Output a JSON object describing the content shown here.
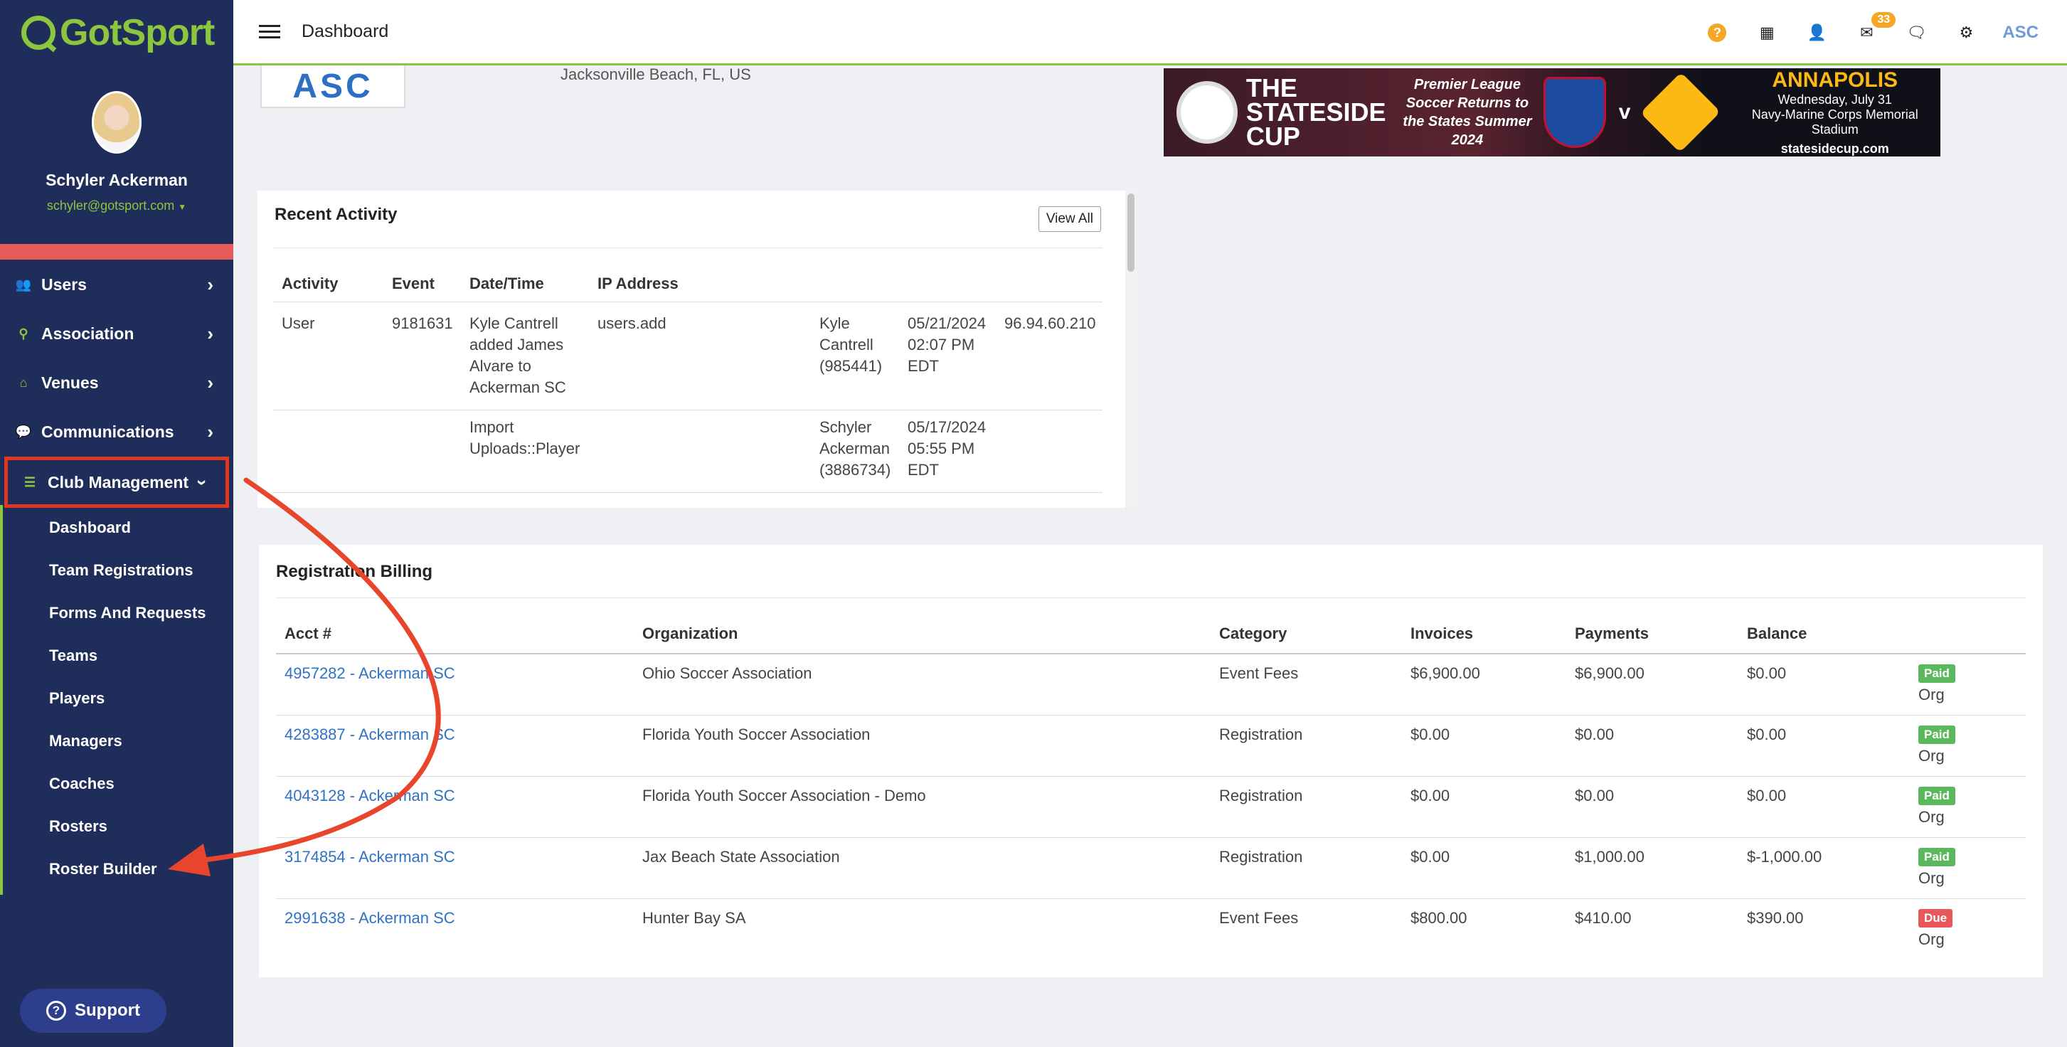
{
  "brand": {
    "logo_text": "GotSport",
    "accent": "#8cc63f"
  },
  "profile": {
    "name": "Schyler Ackerman",
    "email": "schyler@gotsport.com"
  },
  "nav": [
    {
      "label": "Users",
      "icon": "users-icon"
    },
    {
      "label": "Association",
      "icon": "sitemap-icon"
    },
    {
      "label": "Venues",
      "icon": "home-icon"
    },
    {
      "label": "Communications",
      "icon": "chat-icon"
    },
    {
      "label": "Club Management",
      "icon": "list-icon",
      "active": true
    }
  ],
  "subnav": [
    "Dashboard",
    "Team Registrations",
    "Forms And Requests",
    "Teams",
    "Players",
    "Managers",
    "Coaches",
    "Rosters",
    "Roster Builder"
  ],
  "support_label": "Support",
  "header": {
    "title": "Dashboard",
    "message_count": "33",
    "org_abbr": "ASC"
  },
  "club": {
    "logo_text": "ASC",
    "location": "Jacksonville Beach, FL, US"
  },
  "banner": {
    "title": "THE STATESIDE CUP",
    "tagline": "Premier League Soccer Returns to the States Summer 2024",
    "versus": "v",
    "city": "ANNAPOLIS",
    "date": "Wednesday, July 31",
    "venue": "Navy-Marine Corps Memorial Stadium",
    "url": "statesidecup.com"
  },
  "recent_activity": {
    "title": "Recent Activity",
    "view_all": "View All",
    "headers": [
      "Activity",
      "Event",
      "Date/Time",
      "IP Address"
    ],
    "rows": [
      {
        "activity": "User",
        "event": "9181631",
        "description": "Kyle Cantrell added James Alvare to Ackerman SC",
        "action": "users.add",
        "user": "Kyle Cantrell (985441)",
        "datetime": "05/21/2024 02:07 PM EDT",
        "ip": "96.94.60.210"
      },
      {
        "activity": "",
        "event": "",
        "description": "Import Uploads::Player",
        "action": "",
        "user": "Schyler Ackerman (3886734)",
        "datetime": "05/17/2024 05:55 PM EDT",
        "ip": ""
      }
    ]
  },
  "billing": {
    "title": "Registration Billing",
    "headers": [
      "Acct #",
      "Organization",
      "Category",
      "Invoices",
      "Payments",
      "Balance"
    ],
    "rows": [
      {
        "acct": "4957282 - Ackerman SC",
        "org": "Ohio Soccer Association",
        "category": "Event Fees",
        "invoices": "$6,900.00",
        "payments": "$6,900.00",
        "balance": "$0.00",
        "status": "Paid",
        "status_color": "#5cb85c",
        "type": "Org"
      },
      {
        "acct": "4283887 - Ackerman SC",
        "org": "Florida Youth Soccer Association",
        "category": "Registration",
        "invoices": "$0.00",
        "payments": "$0.00",
        "balance": "$0.00",
        "status": "Paid",
        "status_color": "#5cb85c",
        "type": "Org"
      },
      {
        "acct": "4043128 - Ackerman SC",
        "org": "Florida Youth Soccer Association - Demo",
        "category": "Registration",
        "invoices": "$0.00",
        "payments": "$0.00",
        "balance": "$0.00",
        "status": "Paid",
        "status_color": "#5cb85c",
        "type": "Org"
      },
      {
        "acct": "3174854 - Ackerman SC",
        "org": "Jax Beach State Association",
        "category": "Registration",
        "invoices": "$0.00",
        "payments": "$1,000.00",
        "balance": "$-1,000.00",
        "status": "Paid",
        "status_color": "#5cb85c",
        "type": "Org"
      },
      {
        "acct": "2991638 - Ackerman SC",
        "org": "Hunter Bay SA",
        "category": "Event Fees",
        "invoices": "$800.00",
        "payments": "$410.00",
        "balance": "$390.00",
        "status": "Due",
        "status_color": "#e8575a",
        "type": "Org"
      }
    ]
  }
}
